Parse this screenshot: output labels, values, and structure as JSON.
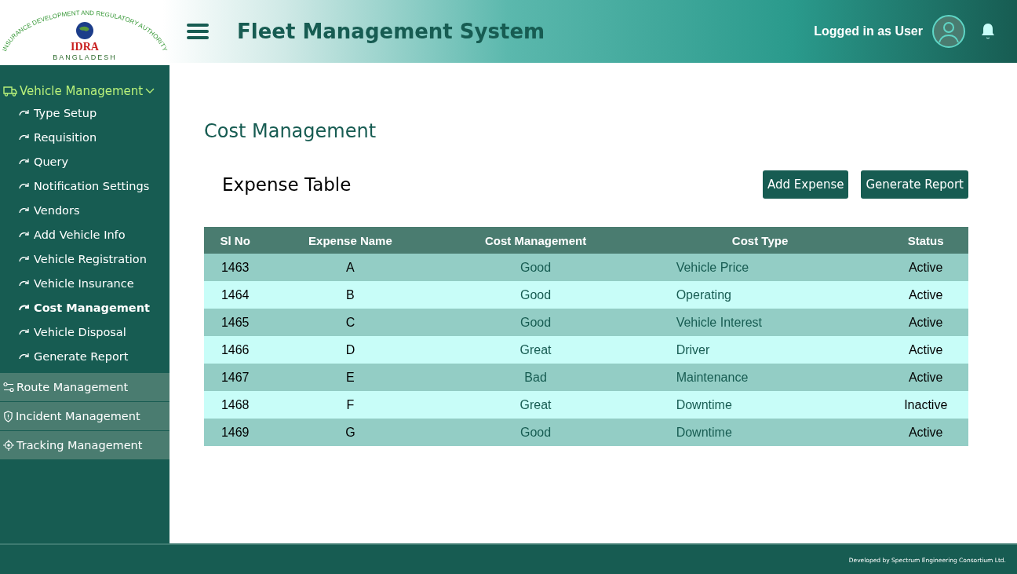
{
  "logo": {
    "arc_text": "INSURANCE DEVELOPMENT AND REGULATORY AUTHORITY",
    "name": "IDRA",
    "country": "BANGLADESH"
  },
  "header": {
    "title": "Fleet Management System",
    "user_label": "Logged in as User"
  },
  "sidebar": {
    "groups": [
      {
        "label": "Vehicle Management",
        "kind": "vehicle",
        "expanded": true,
        "children": [
          {
            "label": "Type Setup",
            "selected": false
          },
          {
            "label": "Requisition",
            "selected": false
          },
          {
            "label": "Query",
            "selected": false
          },
          {
            "label": "Notification Settings",
            "selected": false
          },
          {
            "label": "Vendors",
            "selected": false
          },
          {
            "label": "Add Vehicle Info",
            "selected": false
          },
          {
            "label": "Vehicle Registration",
            "selected": false
          },
          {
            "label": "Vehicle Insurance",
            "selected": false
          },
          {
            "label": "Cost Management",
            "selected": true
          },
          {
            "label": "Vehicle Disposal",
            "selected": false
          },
          {
            "label": "Generate Report",
            "selected": false
          }
        ]
      },
      {
        "label": "Route Management",
        "kind": "route",
        "expanded": false
      },
      {
        "label": "Incident Management",
        "kind": "incident",
        "expanded": false
      },
      {
        "label": "Tracking Management",
        "kind": "tracking",
        "expanded": false
      }
    ]
  },
  "page_title": "Cost Management",
  "table_title": "Expense Table",
  "buttons": [
    "Add Expense",
    "Generate Report"
  ],
  "table": {
    "columns": [
      "Sl No",
      "Expense Name",
      "Cost Management",
      "Cost Type",
      "Status"
    ],
    "rows": [
      [
        "1463",
        "A",
        "Good",
        "Vehicle Price",
        "Active"
      ],
      [
        "1464",
        "B",
        "Good",
        "Operating",
        "Active"
      ],
      [
        "1465",
        "C",
        "Good",
        "Vehicle Interest",
        "Active"
      ],
      [
        "1466",
        "D",
        "Great",
        "Driver",
        "Active"
      ],
      [
        "1467",
        "E",
        "Bad",
        "Maintenance",
        "Active"
      ],
      [
        "1468",
        "F",
        "Great",
        "Downtime",
        "Inactive"
      ],
      [
        "1469",
        "G",
        "Good",
        "Downtime",
        "Active"
      ]
    ]
  },
  "footer": "Developed by Spectrum Engineering Consortium Ltd."
}
